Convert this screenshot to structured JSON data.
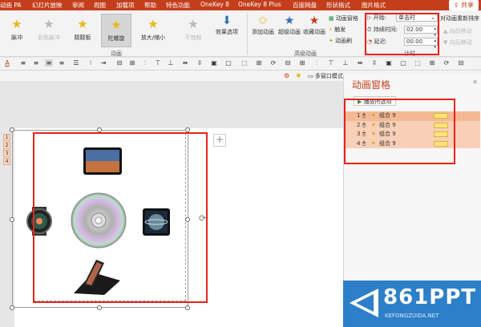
{
  "tabs": {
    "items": [
      "动画 PA",
      "幻灯片放映",
      "审阅",
      "视图",
      "加载项",
      "帮助",
      "特色功能",
      "OneKey 8",
      "OneKey 8 Plus",
      "百度网盘",
      "形状格式",
      "图片格式"
    ],
    "share": "共享"
  },
  "ribbon": {
    "effects": [
      {
        "label": "脉冲",
        "icon": "★",
        "state": "normal"
      },
      {
        "label": "彩色脉冲",
        "icon": "★",
        "state": "disabled"
      },
      {
        "label": "跷跷板",
        "icon": "★",
        "state": "normal"
      },
      {
        "label": "陀螺旋",
        "icon": "★",
        "state": "selected"
      },
      {
        "label": "放大/缩小",
        "icon": "★",
        "state": "normal"
      },
      {
        "label": "不饱和",
        "icon": "★",
        "state": "disabled"
      }
    ],
    "effect_options": "效果选项",
    "group_animation": "动画",
    "add_animation": "添加动画",
    "animation_painter": "动画刷",
    "adv_group": "高级动画",
    "animation_pane": "动画窗格",
    "trigger": "触发",
    "anim_painter_small": "动画刷",
    "timing": {
      "start_label": "开始:",
      "start_value": "单击时",
      "duration_label": "持续时间:",
      "duration_value": "02.00",
      "delay_label": "延迟:",
      "delay_value": "00.00",
      "group": "计时",
      "reorder": "对动画重新排序",
      "move_earlier": "向前移动",
      "move_later": "向后移动"
    },
    "adv_btns": [
      "超级动画",
      "收藏动画"
    ]
  },
  "strip": {
    "multiwindow": "多窗口模式"
  },
  "anim_tags": [
    "1",
    "2",
    "3",
    "4"
  ],
  "pane": {
    "title": "动画窗格",
    "play_button": "播放所选项",
    "items": [
      {
        "num": "1",
        "name": "组合 9"
      },
      {
        "num": "2",
        "name": "组合 9"
      },
      {
        "num": "3",
        "name": "组合 9"
      },
      {
        "num": "4",
        "name": "组合 9"
      }
    ]
  },
  "logo": {
    "text": "861PPT",
    "sub": "KEFONGZUIDA.NET"
  },
  "colors": {
    "accent": "#c43e1c",
    "highlight": "#e8221a"
  }
}
